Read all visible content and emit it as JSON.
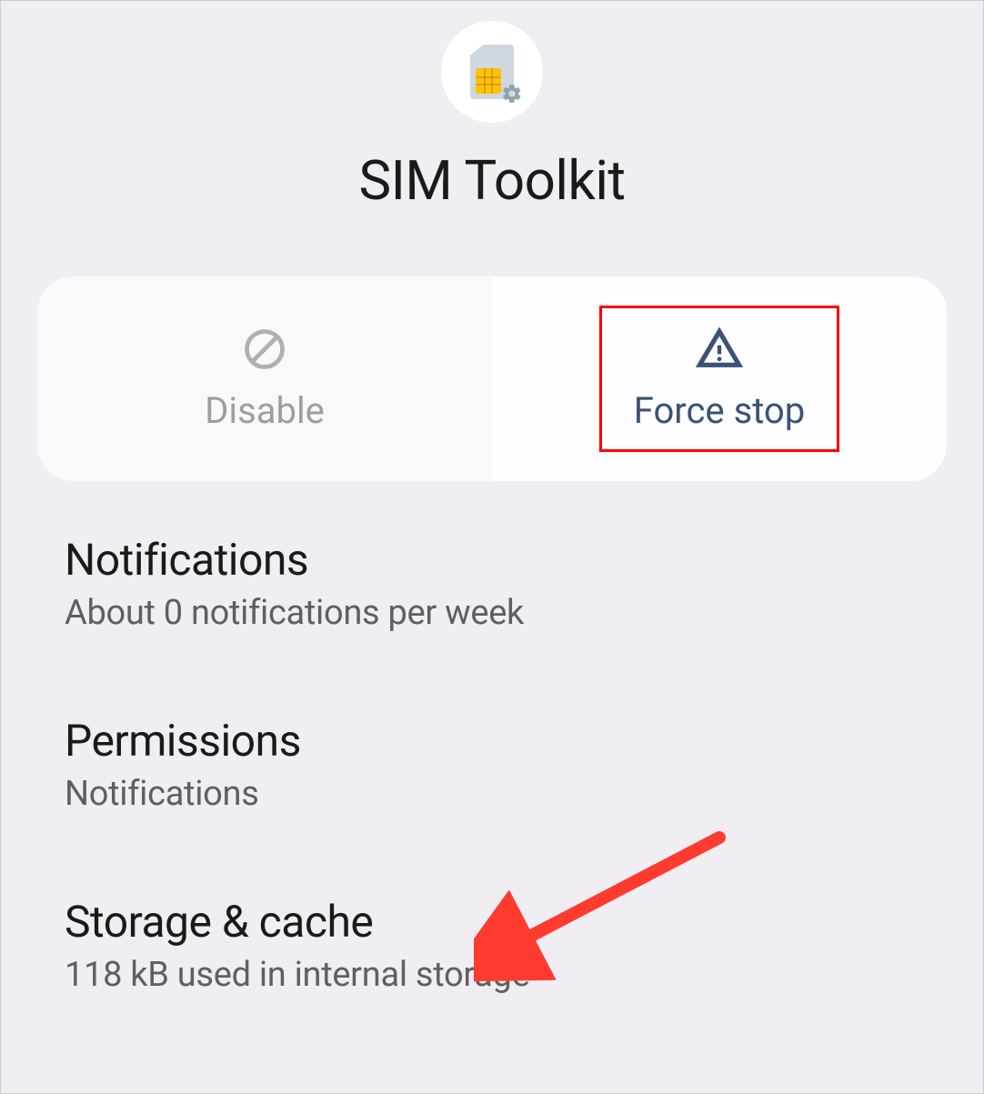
{
  "app": {
    "name": "SIM Toolkit",
    "icon": "sim-card-icon"
  },
  "actions": {
    "disable": {
      "label": "Disable",
      "enabled": false
    },
    "force_stop": {
      "label": "Force stop",
      "enabled": true,
      "highlighted": true
    }
  },
  "settings": [
    {
      "title": "Notifications",
      "subtitle": "About 0 notifications per week"
    },
    {
      "title": "Permissions",
      "subtitle": "Notifications"
    },
    {
      "title": "Storage & cache",
      "subtitle": "118 kB used in internal storage"
    }
  ],
  "annotations": {
    "arrow_target": "storage-cache"
  }
}
